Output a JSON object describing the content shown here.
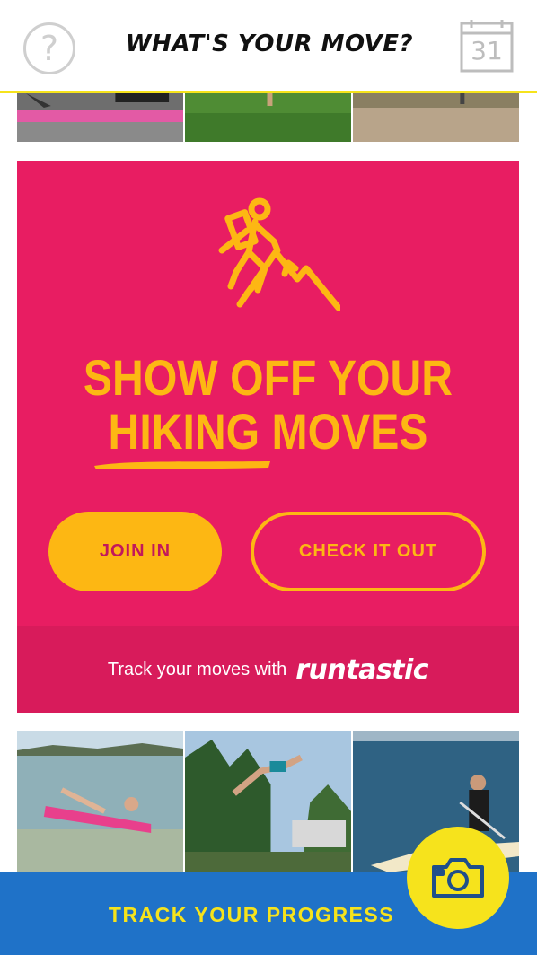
{
  "header": {
    "title": "WHAT'S YOUR MOVE?",
    "help_glyph": "?",
    "calendar_day": "31",
    "help_icon": "question-circle-icon",
    "calendar_icon": "calendar-icon"
  },
  "card": {
    "icon": "hiker-icon",
    "headline_line1": "SHOW OFF YOUR",
    "headline_line2": "HIKING MOVES",
    "join_label": "JOIN IN",
    "check_label": "CHECK IT OUT",
    "track_text": "Track your moves with",
    "brand": "runtastic"
  },
  "bottom": {
    "label": "TRACK YOUR PROGRESS",
    "camera_icon": "camera-icon"
  },
  "colors": {
    "card_bg": "#e81d62",
    "accent_yellow": "#fdb713",
    "bar_blue": "#1f72c8",
    "bar_yellow": "#f6e31c"
  }
}
